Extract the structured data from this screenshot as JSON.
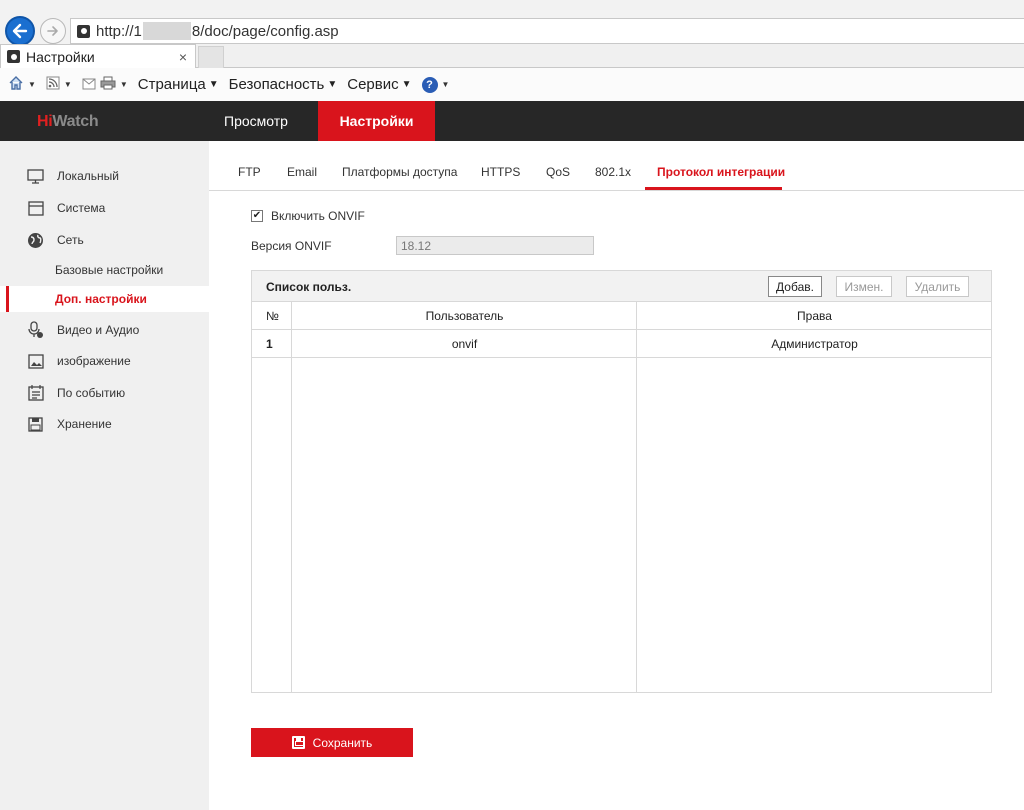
{
  "browser": {
    "url_prefix": "http://1",
    "url_suffix": "8/doc/page/config.asp",
    "tab_title": "Настройки",
    "tab_close": "×",
    "menus": [
      {
        "label": "Страница"
      },
      {
        "label": "Безопасность"
      },
      {
        "label": "Сервис"
      }
    ]
  },
  "header": {
    "logo_hi": "Hi",
    "logo_watch": "Watch",
    "nav_live": "Просмотр",
    "nav_config": "Настройки"
  },
  "sidebar": {
    "items": [
      {
        "label": "Локальный",
        "icon": "monitor-icon"
      },
      {
        "label": "Система",
        "icon": "window-icon"
      },
      {
        "label": "Сеть",
        "icon": "globe-icon"
      },
      {
        "label": "Базовые настройки"
      },
      {
        "label": "Доп. настройки",
        "active": true
      },
      {
        "label": "Видео и Аудио",
        "icon": "microphone-icon"
      },
      {
        "label": "изображение",
        "icon": "image-icon"
      },
      {
        "label": "По событию",
        "icon": "calendar-icon"
      },
      {
        "label": "Хранение",
        "icon": "disk-icon"
      }
    ]
  },
  "subtabs": [
    {
      "label": "FTP"
    },
    {
      "label": "Email"
    },
    {
      "label": "Платформы доступа"
    },
    {
      "label": "HTTPS"
    },
    {
      "label": "QoS"
    },
    {
      "label": "802.1x"
    },
    {
      "label": "Протокол интеграции",
      "active": true
    }
  ],
  "onvif": {
    "enable_label": "Включить ONVIF",
    "enabled": true,
    "version_label": "Версия ONVIF",
    "version_value": "18.12"
  },
  "user_list": {
    "title": "Список польз.",
    "add_label": "Добав.",
    "edit_label": "Измен.",
    "delete_label": "Удалить",
    "columns": [
      "№",
      "Пользователь",
      "Права"
    ],
    "rows": [
      {
        "no": "1",
        "user": "onvif",
        "rights": "Администратор"
      }
    ]
  },
  "save_label": "Сохранить",
  "colors": {
    "accent": "#d9141c",
    "header_bg": "#272727",
    "sidebar_bg": "#f0f0f0"
  }
}
